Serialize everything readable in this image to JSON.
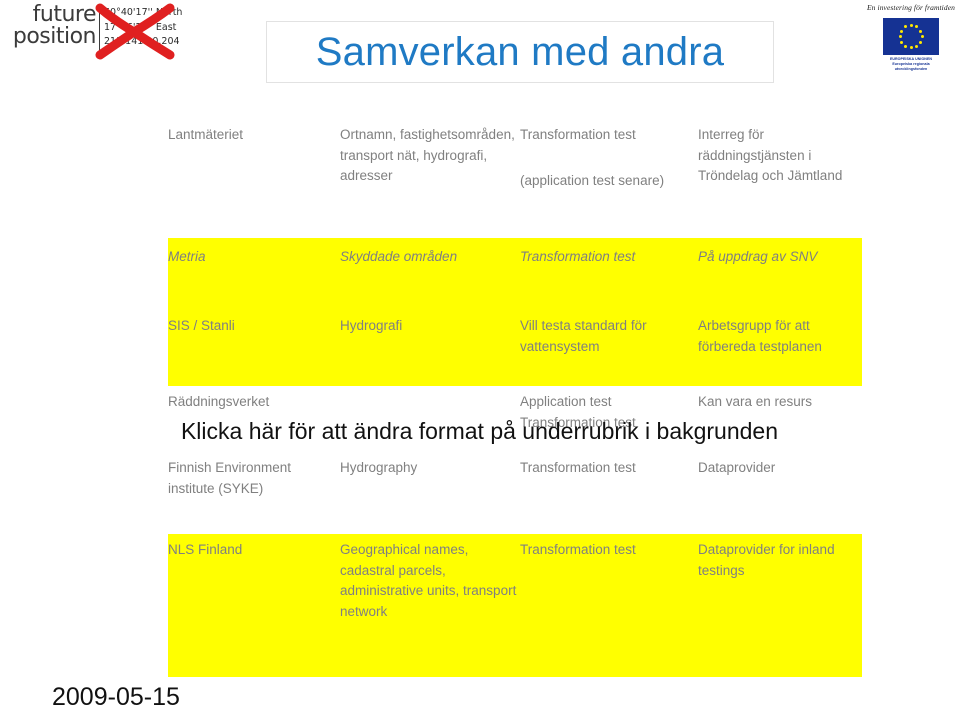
{
  "branding": {
    "future_position": {
      "line1": "future",
      "line2": "position",
      "coord_lat": "60°40'17'' North",
      "coord_lon": "17°06'29'' East",
      "coord_ip": "213.141.90.204",
      "cross_color": "#e02020"
    },
    "eu": {
      "tagline": "En investering för framtiden",
      "line1": "EUROPEISKA UNIONEN",
      "line2": "Europeiska regionala",
      "line3": "utvecklingsfonden",
      "flag_color": "#153293",
      "star_color": "#ffe800"
    }
  },
  "slide": {
    "title": "Samverkan med andra",
    "title_color": "#1f7ac4",
    "highlight_color": "#ffff00",
    "body_color": "#808080",
    "subtitle_placeholder": "Klicka här för att ändra format på underrubrik i bakgrunden",
    "date": "2009-05-15"
  },
  "table": {
    "rows": [
      {
        "highlight": false,
        "italic": false,
        "organisation": "Lantmäteriet",
        "data": "Ortnamn, fastighetsområden, transport nät, hydrografi, adresser",
        "test": "Transformation test",
        "test_extra": "(application test senare)",
        "comment": "Interreg för räddningstjänsten i Tröndelag och Jämtland"
      },
      {
        "highlight": true,
        "italic": true,
        "organisation": "Metria",
        "data": "Skyddade områden",
        "test": "Transformation test",
        "test_extra": "",
        "comment": "På uppdrag av SNV"
      },
      {
        "highlight": true,
        "italic": false,
        "organisation": "SIS / Stanli",
        "data": "Hydrografi",
        "test": "Vill testa standard för vattensystem",
        "test_extra": "",
        "comment": "Arbetsgrupp för att förbereda testplanen"
      },
      {
        "highlight": false,
        "italic": false,
        "organisation": "Räddningsverket",
        "data": "",
        "test": "Application test",
        "test_extra": "Transformation test",
        "comment": "Kan vara en resurs"
      },
      {
        "highlight": false,
        "italic": false,
        "organisation": "Finnish Environment institute (SYKE)",
        "data": "Hydrography",
        "test": "Transformation test",
        "test_extra": "",
        "comment": "Dataprovider"
      },
      {
        "highlight": true,
        "italic": false,
        "organisation": "NLS Finland",
        "data": "Geographical names, cadastral parcels, administrative units, transport network",
        "test": "Transformation test",
        "test_extra": "",
        "comment": "Dataprovider for inland testings"
      }
    ]
  }
}
